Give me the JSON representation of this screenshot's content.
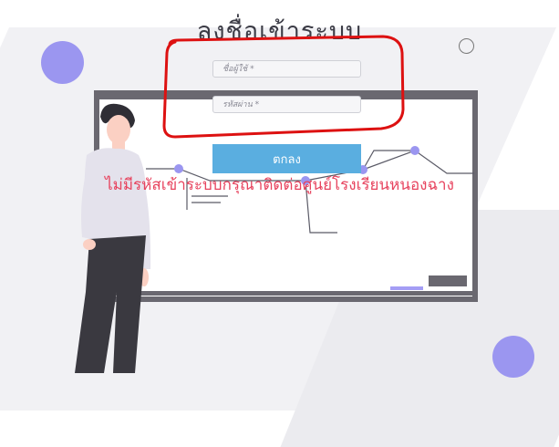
{
  "page": {
    "title": "ลงชื่อเข้าระบบ"
  },
  "login_form": {
    "username_placeholder": "ชื่อผู้ใช้ *",
    "password_placeholder": "รหัสผ่าน *",
    "submit_label": "ตกลง"
  },
  "notice": {
    "text": "ไม่มีรหัสเข้าระบบกรุณาติดต่อศูนย์โรงเรียนหนองฉาง"
  },
  "colors": {
    "accent_purple": "#9b96f0",
    "button_blue": "#5aaee0",
    "notice_red": "#e7435e",
    "annotation_red": "#dd1111",
    "board_frame": "#6a6870"
  },
  "icons": [
    "person-illustration",
    "circle-decoration"
  ]
}
